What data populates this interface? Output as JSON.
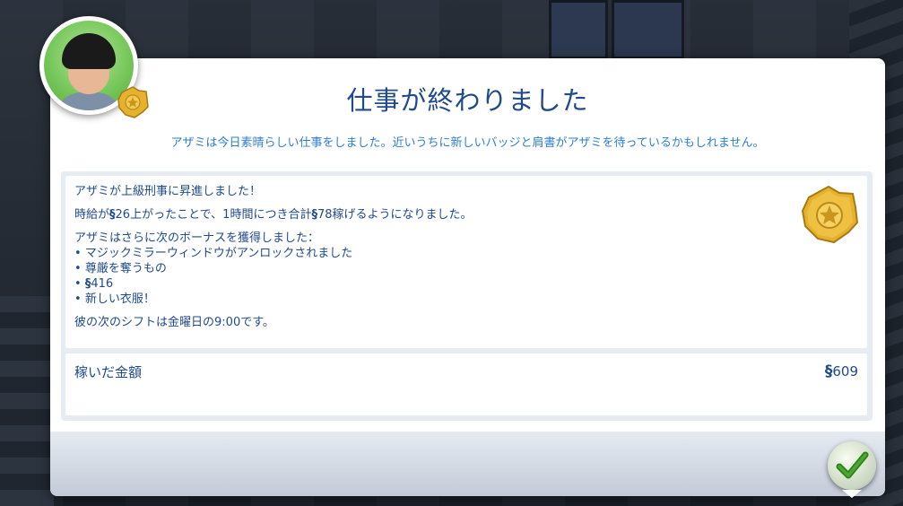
{
  "dialog": {
    "title": "仕事が終わりました",
    "subtitle": "アザミは今日素晴らしい仕事をしました。近いうちに新しいバッジと肩書がアザミを待っているかもしれません。"
  },
  "message": {
    "promotion": "アザミが上級刑事に昇進しました！",
    "raise_prefix": "時給が",
    "raise_amount": "26",
    "raise_middle": "上がったことで、",
    "raise_hours": "1",
    "raise_middle2": "時間につき合計",
    "raise_total": "78",
    "raise_suffix": "稼げるようになりました。",
    "bonus_intro": "アザミはさらに次のボーナスを獲得しました：",
    "bonus_items": [
      "マジックミラーウィンドウがアンロックされました",
      "尊厳を奪うもの",
      "416",
      "新しい衣服！"
    ],
    "shift_prefix": "彼の次のシフトは金曜日の",
    "shift_time": "9:00",
    "shift_suffix": "です。"
  },
  "earned": {
    "label": "稼いだ金額",
    "value": "609"
  },
  "currency_symbol": "§",
  "icons": {
    "avatar": "sim-portrait",
    "career_badge": "detective-badge-icon",
    "confirm": "checkmark-icon"
  },
  "colors": {
    "title": "#1f4a8c",
    "subtitle": "#2e7fcf",
    "confirm_check": "#2f7d1e",
    "badge_gold": "#e6b12e"
  }
}
